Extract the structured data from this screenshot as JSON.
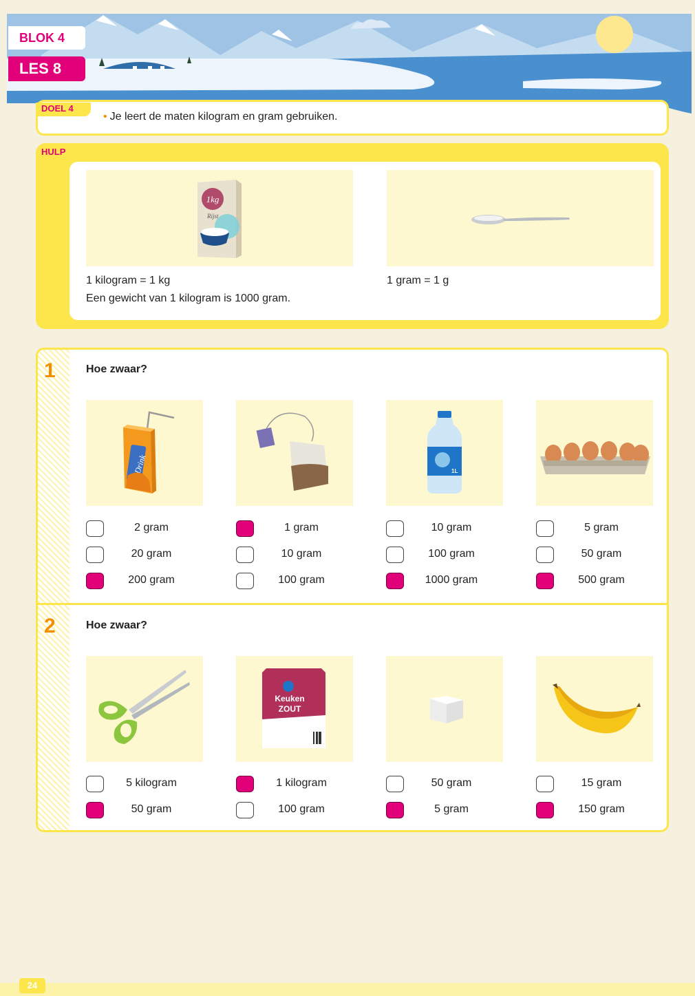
{
  "header": {
    "blok_label": "BLOK 4",
    "les_label": "LES 8"
  },
  "doel": {
    "tag": "DOEL 4",
    "text": "Je leert de maten kilogram en gram gebruiken."
  },
  "hulp": {
    "tag": "HULP",
    "items": [
      {
        "icon": "rice-box-icon",
        "box_label": "1kg",
        "box_sub": "Rijst",
        "lines": [
          "1 kilogram = 1 kg",
          "Een gewicht van 1 kilogram is 1000 gram."
        ]
      },
      {
        "icon": "spoon-icon",
        "lines": [
          "1 gram = 1 g"
        ]
      }
    ]
  },
  "exercises": [
    {
      "number": "1",
      "question": "Hoe zwaar?",
      "items": [
        {
          "icon": "juice-carton-icon",
          "pic_label": "Drink",
          "options": [
            {
              "label": "2 gram",
              "checked": false
            },
            {
              "label": "20 gram",
              "checked": false
            },
            {
              "label": "200 gram",
              "checked": true
            }
          ]
        },
        {
          "icon": "tea-bag-icon",
          "options": [
            {
              "label": "1 gram",
              "checked": true
            },
            {
              "label": "10 gram",
              "checked": false
            },
            {
              "label": "100 gram",
              "checked": false
            }
          ]
        },
        {
          "icon": "water-bottle-icon",
          "pic_label": "1L",
          "options": [
            {
              "label": "10 gram",
              "checked": false
            },
            {
              "label": "100 gram",
              "checked": false
            },
            {
              "label": "1000 gram",
              "checked": true
            }
          ]
        },
        {
          "icon": "egg-carton-icon",
          "options": [
            {
              "label": "5 gram",
              "checked": false
            },
            {
              "label": "50 gram",
              "checked": false
            },
            {
              "label": "500 gram",
              "checked": true
            }
          ]
        }
      ]
    },
    {
      "number": "2",
      "question": "Hoe zwaar?",
      "items": [
        {
          "icon": "scissors-icon",
          "options": [
            {
              "label": "5 kilogram",
              "checked": false
            },
            {
              "label": "50 gram",
              "checked": true
            }
          ]
        },
        {
          "icon": "salt-bag-icon",
          "pic_label_1": "Keuken",
          "pic_label_2": "ZOUT",
          "options": [
            {
              "label": "1 kilogram",
              "checked": true
            },
            {
              "label": "100 gram",
              "checked": false
            }
          ]
        },
        {
          "icon": "sugar-cube-icon",
          "options": [
            {
              "label": "50 gram",
              "checked": false
            },
            {
              "label": "5 gram",
              "checked": true
            }
          ]
        },
        {
          "icon": "banana-icon",
          "options": [
            {
              "label": "15 gram",
              "checked": false
            },
            {
              "label": "150 gram",
              "checked": true
            }
          ]
        }
      ]
    }
  ],
  "footer": {
    "page_number": "24"
  },
  "colors": {
    "magenta": "#e2007a",
    "yellow": "#fde64b",
    "orange": "#f29100"
  }
}
